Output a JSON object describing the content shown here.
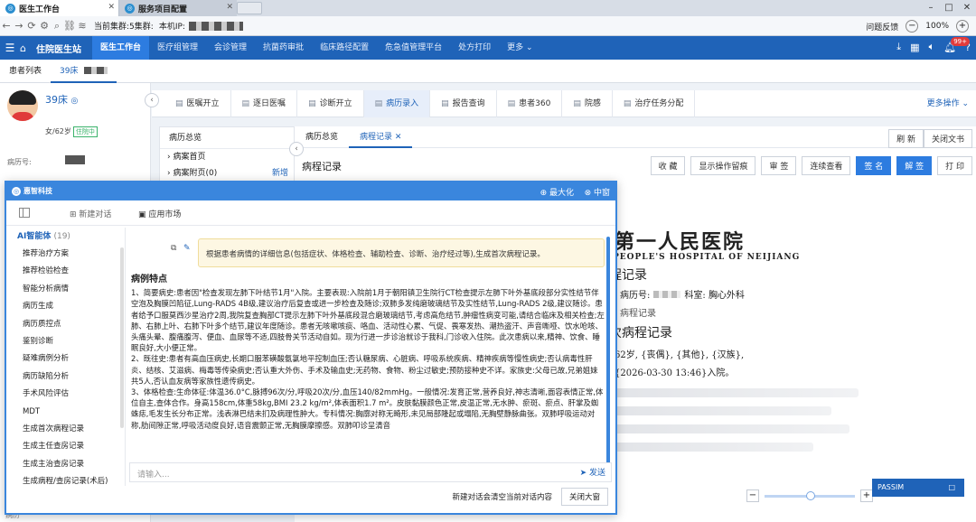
{
  "browser": {
    "tabs": [
      {
        "label": "医生工作台",
        "active": true
      },
      {
        "label": "服务项目配置",
        "active": false
      }
    ],
    "window_controls": [
      "–",
      "□",
      "✕"
    ],
    "current_cluster_label": "当前集群:",
    "current_cluster_value": "5集群:",
    "local_ip_label": "本机IP:",
    "feedback": "问题反馈",
    "zoom": "100%"
  },
  "appnav": {
    "site_title": "住院医生站",
    "items": [
      "医生工作台",
      "医疗组管理",
      "会诊管理",
      "抗菌药审批",
      "临床路径配置",
      "危急值管理平台",
      "处方打印",
      "更多"
    ],
    "active_index": 0,
    "badge": "99+"
  },
  "patient_tabs": [
    "患者列表",
    "39床"
  ],
  "patient": {
    "bed": "39床",
    "gender_age": "女/62岁",
    "status": "住院中",
    "mrn_label": "病历号:",
    "footer": "病历"
  },
  "main_tabs": [
    "医嘱开立",
    "逐日医嘱",
    "诊断开立",
    "病历录入",
    "报告查询",
    "患者360",
    "院感",
    "治疗任务分配"
  ],
  "main_tabs_active": 3,
  "more_ops": "更多操作",
  "record_tree": {
    "header": "病历总览",
    "rows": [
      "病案首页",
      "病案附页(0)"
    ],
    "new_label": "新增"
  },
  "doc": {
    "tabs": [
      "病历总览",
      "病程记录"
    ],
    "active_tab": 1,
    "refresh": "刷 新",
    "close_all": "关闭文书",
    "title": "病程记录",
    "toolbar": [
      "收 藏",
      "显示操作留痕",
      "审 签",
      "连续查看",
      "签 名",
      "解 签",
      "打 印"
    ],
    "hospital_name": "第一人民医院",
    "hospital_en": "PEOPLE'S HOSPITAL OF NEIJIANG",
    "record_heading": "程记录",
    "mrn_label": "病历号:",
    "dept_label": "科室:",
    "dept_value": "胸心外科",
    "section": "病程记录",
    "first_heading": "次病程记录",
    "line1": "62岁, {丧偶}, {其他}, {汉族},",
    "line2": "{2026-03-30 13:46}入院。"
  },
  "zoom_controls": {
    "minus": "−",
    "plus": "+"
  },
  "passim": {
    "label": "PASSIM",
    "btn": "□"
  },
  "ai": {
    "brand": "惠智科技",
    "maximize": "最大化",
    "middle": "中窗",
    "new_chat": "新建对话",
    "app_market": "应用市场",
    "agents_header": "AI智能体",
    "agents_count": "(19)",
    "agents": [
      "推荐治疗方案",
      "推荐检验检查",
      "智能分析病情",
      "病历生成",
      "病历质控点",
      "鉴别诊断",
      "疑难病例分析",
      "病历缺陷分析",
      "手术风险评估",
      "MDT",
      "生成首次病程记录",
      "生成主任查房记录",
      "生成主治查房记录",
      "生成病程/查房记录(术后)"
    ],
    "prompt": "根据患者病情的详细信息(包括症状、体格检查、辅助检查、诊断、治疗经过等),生成首次病程记录。",
    "answer_title": "病例特点",
    "answer_paragraphs": [
      "1、简要病史:患者因\"检查发现左肺下叶结节1月\"入院。主要表现:入院前1月于朝阳镇卫生院行CT检查提示左肺下叶外基底段部分实性结节伴空泡及胸膜凹陷征,Lung-RADS 4B级,建议治疗后复查或进一步检查及随诊;双肺多发纯磨玻璃结节及实性结节,Lung-RADS 2级,建议随诊。患者给予口服莫西沙星治疗2周,我院复查胸部CT提示左肺下叶外基底段混合磨玻璃结节,考虑高危结节,肿瘤性病变可能,请结合临床及相关检查;左肺、右肺上叶、右肺下叶多个结节,建议年度随诊。患者无咳嗽咳痰、咯血、活动性心累、气促、畏寒发热、潮热盗汗、声音嘶哑、饮水呛咳、头痛头晕、腹痛腹泻、便血、血尿等不适,四肢骨关节活动自如。现为行进一步诊治就诊于我科,门诊收入住院。此次患病以来,精神、饮食、睡眠良好,大小便正常。",
      "2、既往史:患者有高血压病史,长期口服苯磺酸氨氯地平控制血压;否认糖尿病、心脏病、呼吸系统疾病、精神疾病等慢性病史;否认病毒性肝炎、结核、艾滋病、梅毒等传染病史;否认重大外伤、手术及输血史;无药物、食物、粉尘过敏史;预防接种史不详。家族史:父母已故,兄弟姐妹共5人,否认血友病等家族性遗传病史。",
      "3、体格检查:生命体征:体温36.0°C,脉搏96次/分,呼吸20次/分,血压140/82mmHg。一般情况:发育正常,营养良好,神志清晰,面容表情正常,体位自主,查体合作。身高158cm,体重58kg,BMI 23.2 kg/m²,体表面积1.7 m²。皮肤黏膜颜色正常,皮温正常,无水肿、瘀斑、瘀点、肝掌及蜘蛛痣,毛发生长分布正常。浅表淋巴结未扪及病理性肿大。专科情况:胸廓对称无畸形,未见局部隆起或塌陷,无胸壁静脉曲张。双肺呼吸运动对称,肋间隙正常,呼吸活动度良好,语音震颤正常,无胸膜摩擦感。双肺叩诊呈清音"
    ],
    "input_placeholder": "请输入...",
    "send": "发送",
    "footer_note": "新建对话会清空当前对话内容",
    "close_big": "关闭大窗"
  }
}
